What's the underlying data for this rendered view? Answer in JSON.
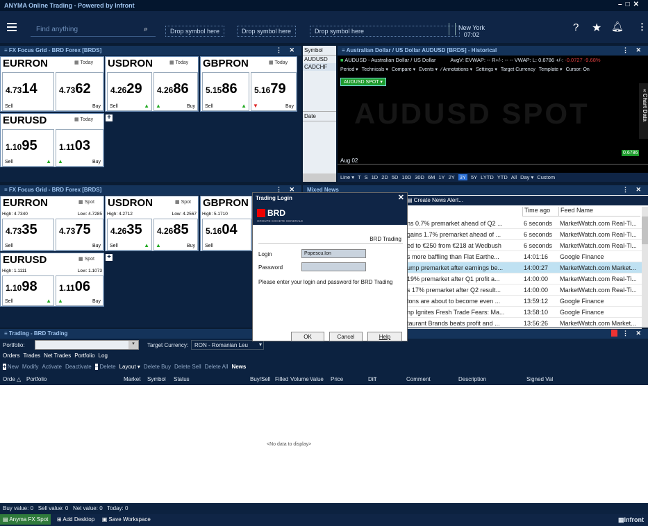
{
  "app": {
    "title": "ANYMA Online Trading - Powered by Infront",
    "search_placeholder": "Find anything",
    "drop1": "Drop symbol here",
    "drop2": "Drop symbol here",
    "drop3": "Drop symbol here",
    "city": "New York",
    "time": "07:02"
  },
  "grid1": {
    "title": "FX Focus Grid - BRD Forex [BRDS]",
    "tiles": [
      {
        "ccy": "EURRON",
        "period": "Today",
        "sell_pre": "4.73",
        "sell_big": "14",
        "buy_pre": "4.73",
        "buy_big": "62",
        "sell": "Sell",
        "buy": "Buy"
      },
      {
        "ccy": "USDRON",
        "period": "Today",
        "sell_pre": "4.26",
        "sell_big": "29",
        "buy_pre": "4.26",
        "buy_big": "86",
        "sell": "Sell",
        "buy": "Buy"
      },
      {
        "ccy": "GBPRON",
        "period": "Today",
        "sell_pre": "5.15",
        "sell_big": "86",
        "buy_pre": "5.16",
        "buy_big": "79",
        "sell": "Sell",
        "buy": "Buy"
      },
      {
        "ccy": "EURUSD",
        "period": "Today",
        "sell_pre": "1.10",
        "sell_big": "95",
        "buy_pre": "1.11",
        "buy_big": "03",
        "sell": "Sell",
        "buy": "Buy"
      }
    ]
  },
  "symbols": {
    "header": "Symbol",
    "items": [
      "AUDUSD",
      "CADCHF"
    ],
    "date_label": "Date"
  },
  "chart": {
    "title": "Australian Dollar / US Dollar AUDUSD [BRDS] - Historical",
    "info": "AUDUSD - Australian Dollar / US Dollar",
    "stats": "AvgV:  EVWAP: --  R+/-: --  --  VWAP:  L: 0.6786  +/-:",
    "change": "-0.0727  -9.68%",
    "menu": [
      "Period ▾",
      "Technicals ▾",
      "Compare ▾",
      "Events ▾",
      "⁄ Annotations ▾",
      "Settings ▾",
      "Target Currency",
      "Template ▾",
      "Cursor: On"
    ],
    "series_tag": "AUDUSD SPOT ▾",
    "watermark": "AUDUSD SPOT",
    "date": "Aug 02",
    "last_value": "0.6786",
    "side_label": "Chart Data",
    "ranges": [
      "Line ▾",
      "T",
      "S",
      "1D",
      "2D",
      "5D",
      "10D",
      "30D",
      "6M",
      "1Y",
      "2Y",
      "3Y",
      "5Y",
      "LYTD",
      "YTD",
      "All",
      "Day ▾",
      "Custom"
    ],
    "active_range": "3Y"
  },
  "grid2": {
    "title": "FX Focus Grid - BRD Forex [BRDS]",
    "tiles": [
      {
        "ccy": "EURRON",
        "period": "Spot",
        "high": "High: 4.7340",
        "low": "Low: 4.7285",
        "sell_pre": "4.73",
        "sell_big": "35",
        "buy_pre": "4.73",
        "buy_big": "75"
      },
      {
        "ccy": "USDRON",
        "period": "Spot",
        "high": "High: 4.2712",
        "low": "Low: 4.2567",
        "sell_pre": "4.26",
        "sell_big": "35",
        "buy_pre": "4.26",
        "buy_big": "85"
      },
      {
        "ccy": "GBPRON",
        "period": "Spot",
        "high": "High: 5.1710",
        "low": "",
        "sell_pre": "5.16",
        "sell_big": "04",
        "buy_pre": "",
        "buy_big": ""
      },
      {
        "ccy": "EURUSD",
        "period": "Spot",
        "high": "High: 1.1111",
        "low": "Low: 1.1073",
        "sell_pre": "1.10",
        "sell_big": "98",
        "buy_pre": "1.11",
        "buy_big": "06"
      }
    ],
    "sell": "Sell",
    "buy": "Buy"
  },
  "news": {
    "title": "Mixed News",
    "create": "Create News Alert...",
    "col_time": "Time ago",
    "col_feed": "Feed Name",
    "rows": [
      {
        "headline": "ns 0.7% premarket ahead of Q2 ...",
        "time": "6 seconds",
        "feed": "MarketWatch.com Real-Ti..."
      },
      {
        "headline": "gains 1.7% premarket ahead of ...",
        "time": "6 seconds",
        "feed": "MarketWatch.com Real-Ti..."
      },
      {
        "headline": "ed to €250 from €218 at Wedbush",
        "time": "6 seconds",
        "feed": "MarketWatch.com Real-Ti..."
      },
      {
        "headline": "s more baffling than Flat Earthe...",
        "time": "14:01:16",
        "feed": "Google Finance"
      },
      {
        "headline": "ump premarket after earnings be...",
        "time": "14:00:27",
        "feed": "MarketWatch.com Market..."
      },
      {
        "headline": "19% premarket after Q1 profit a...",
        "time": "14:00:00",
        "feed": "MarketWatch.com Real-Ti..."
      },
      {
        "headline": "s 17% premarket after Q2 result...",
        "time": "14:00:00",
        "feed": "MarketWatch.com Real-Ti..."
      },
      {
        "headline": "tons are about to become even ...",
        "time": "13:59:12",
        "feed": "Google Finance"
      },
      {
        "headline": "np Ignites Fresh Trade Fears: Ma...",
        "time": "13:58:10",
        "feed": "Google Finance"
      },
      {
        "headline": "taurant Brands beats profit and ...",
        "time": "13:56:26",
        "feed": "MarketWatch.com Market..."
      }
    ]
  },
  "login": {
    "title": "Trading Login",
    "brand": "BRD",
    "brand_sub": "GROUPE SOCIETE GENERALE",
    "subtitle": "BRD Trading",
    "login_label": "Login",
    "login_value": "Popescu.Ion",
    "password_label": "Password",
    "message": "Please enter your login and password for BRD Trading",
    "ok": "OK",
    "cancel": "Cancel",
    "help": "Help"
  },
  "trading": {
    "title": "Trading - BRD Trading",
    "portfolio_label": "Portfolio:",
    "target_label": "Target Currency:",
    "target_value": "RON - Romanian Leu",
    "tabs": [
      "Orders",
      "Trades",
      "Net Trades",
      "Portfolio",
      "Log"
    ],
    "actions": [
      "New",
      "Modify",
      "Activate",
      "Deactivate",
      "Delete",
      "Layout ▾",
      "Delete Buy",
      "Delete Sell",
      "Delete All",
      "News"
    ],
    "columns": [
      "Orde △",
      "Portfolio",
      "Market",
      "Symbol",
      "Status",
      "Buy/Sell",
      "Filled",
      "Volume",
      "Value",
      "Price",
      "Diff",
      "Comment",
      "Description",
      "Signed Val"
    ],
    "empty": "<No data to display>",
    "summary": "Buy value: 0   Sell value: 0   Net value: 0   Today: 0"
  },
  "footer": {
    "btn1": "Anyma FX Spot",
    "btn2": "Add Desktop",
    "btn3": "Save Workspace",
    "brand": "Infront"
  }
}
